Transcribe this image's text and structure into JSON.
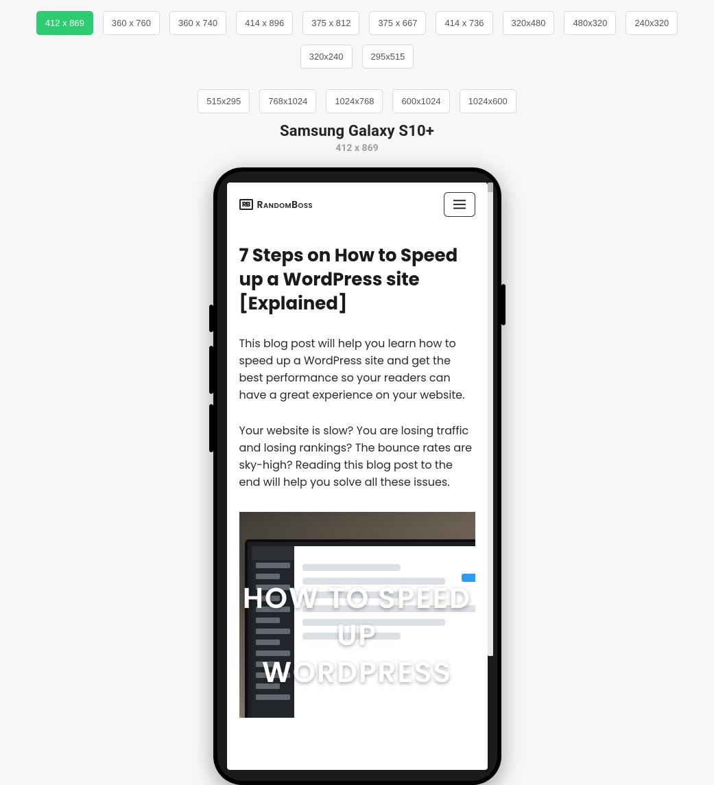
{
  "resolutions_row1": [
    {
      "label": "412 x 869",
      "active": true
    },
    {
      "label": "360 x 760",
      "active": false
    },
    {
      "label": "360 x 740",
      "active": false
    },
    {
      "label": "414 x 896",
      "active": false
    },
    {
      "label": "375 x 812",
      "active": false
    },
    {
      "label": "375 x 667",
      "active": false
    },
    {
      "label": "414 x 736",
      "active": false
    },
    {
      "label": "320x480",
      "active": false
    },
    {
      "label": "480x320",
      "active": false
    },
    {
      "label": "240x320",
      "active": false
    },
    {
      "label": "320x240",
      "active": false
    },
    {
      "label": "295x515",
      "active": false
    }
  ],
  "resolutions_row2": [
    {
      "label": "515x295"
    },
    {
      "label": "768x1024"
    },
    {
      "label": "1024x768"
    },
    {
      "label": "600x1024"
    },
    {
      "label": "1024x600"
    }
  ],
  "device": {
    "name": "Samsung Galaxy S10+",
    "dimensions": "412 x 869"
  },
  "site": {
    "brand": "RandomBoss",
    "logo_mark": "RB",
    "post_title": "7 Steps on How to Speed up a WordPress site [Explained]",
    "para1": "This blog post will help you learn how to speed up a WordPress site and get the best performance so your readers can have a great experience on your website.",
    "para2": "Your website is slow? You are losing traffic and losing rankings? The bounce rates are sky-high? Reading this blog post to the end will help you solve all these issues.",
    "hero_overlay": "HOW TO SPEED UP WORDPRESS"
  }
}
